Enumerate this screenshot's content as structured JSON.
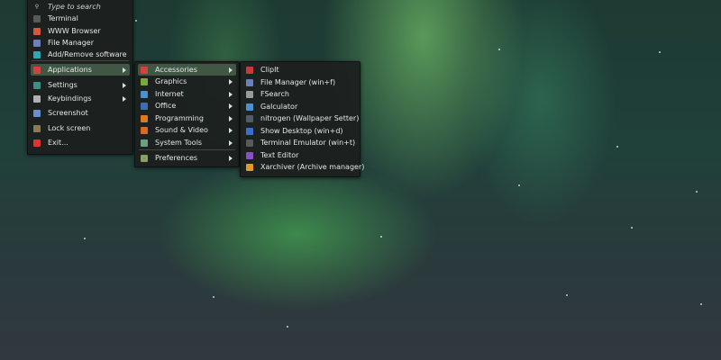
{
  "colors": {
    "active_highlight": "#405745",
    "menu_bg": "#1c1f1e"
  },
  "main_menu": {
    "search_placeholder": "Type to search",
    "items": [
      {
        "label": "Terminal",
        "icon": "terminal-icon",
        "color": "#555b58"
      },
      {
        "label": "WWW Browser",
        "icon": "browser-icon",
        "color": "#d8573a"
      },
      {
        "label": "File Manager",
        "icon": "folder-icon",
        "color": "#6b7fb8"
      },
      {
        "label": "Add/Remove software",
        "icon": "package-icon",
        "color": "#2fa6b8"
      },
      {
        "label": "Applications",
        "icon": "applications-icon",
        "color": "#d84040",
        "submenu": true,
        "active": true
      },
      {
        "label": "Settings",
        "icon": "settings-icon",
        "color": "#3c8f86",
        "submenu": true
      },
      {
        "label": "Keybindings",
        "icon": "keyboard-icon",
        "color": "#b0b0b0",
        "submenu": true
      },
      {
        "label": "Screenshot",
        "icon": "camera-icon",
        "color": "#6a8fd0"
      },
      {
        "label": "Lock screen",
        "icon": "lock-icon",
        "color": "#8a7b55"
      },
      {
        "label": "Exit...",
        "icon": "power-icon",
        "color": "#d33"
      }
    ]
  },
  "apps_menu": {
    "items": [
      {
        "label": "Accessories",
        "icon": "accessories-icon",
        "color": "#d84040",
        "active": true
      },
      {
        "label": "Graphics",
        "icon": "graphics-icon",
        "color": "#7aa83a"
      },
      {
        "label": "Internet",
        "icon": "internet-icon",
        "color": "#4a8fd0"
      },
      {
        "label": "Office",
        "icon": "office-icon",
        "color": "#3a6fb0"
      },
      {
        "label": "Programming",
        "icon": "programming-icon",
        "color": "#d87a20"
      },
      {
        "label": "Sound & Video",
        "icon": "multimedia-icon",
        "color": "#d86a20"
      },
      {
        "label": "System Tools",
        "icon": "system-tools-icon",
        "color": "#6aa080"
      },
      {
        "label": "Preferences",
        "icon": "preferences-icon",
        "color": "#8aa060"
      }
    ]
  },
  "accessories_menu": {
    "items": [
      {
        "label": "ClipIt",
        "icon": "clipboard-icon",
        "color": "#c83a3a"
      },
      {
        "label": "File Manager (win+f)",
        "icon": "folder-icon",
        "color": "#6b7fb8"
      },
      {
        "label": "FSearch",
        "icon": "search-icon",
        "color": "#9a9a9a"
      },
      {
        "label": "Galculator",
        "icon": "calculator-icon",
        "color": "#4a8fd0"
      },
      {
        "label": "nitrogen (Wallpaper Setter)",
        "icon": "wallpaper-icon",
        "color": "#555a66"
      },
      {
        "label": "Show Desktop (win+d)",
        "icon": "desktop-icon",
        "color": "#3a6fd0"
      },
      {
        "label": "Terminal Emulator (win+t)",
        "icon": "terminal-icon",
        "color": "#555b58"
      },
      {
        "label": "Text Editor",
        "icon": "text-editor-icon",
        "color": "#8a4fc0"
      },
      {
        "label": "Xarchiver (Archive manager)",
        "icon": "archive-icon",
        "color": "#e09a30"
      }
    ]
  }
}
